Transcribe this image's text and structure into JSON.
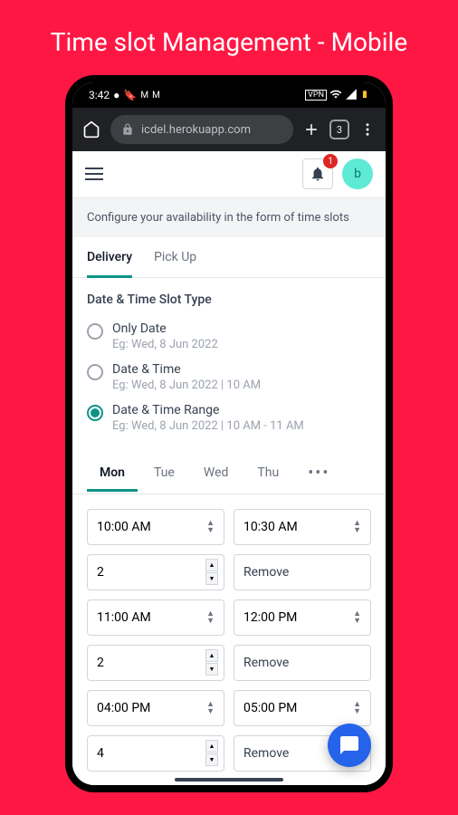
{
  "page": {
    "title": "Time slot Management - Mobile"
  },
  "status": {
    "time": "3:42"
  },
  "browser": {
    "url": "icdel.herokuapp.com",
    "tabs": "3"
  },
  "header": {
    "notification_count": "1",
    "avatar_letter": "b"
  },
  "info": {
    "banner": "Configure your availability in the form of time slots"
  },
  "main_tabs": {
    "delivery": "Delivery",
    "pickup": "Pick Up"
  },
  "slot_type": {
    "title": "Date & Time Slot Type",
    "options": [
      {
        "label": "Only Date",
        "example": "Eg: Wed, 8 Jun 2022",
        "selected": false
      },
      {
        "label": "Date & Time",
        "example": "Eg: Wed, 8 Jun 2022 | 10 AM",
        "selected": false
      },
      {
        "label": "Date & Time Range",
        "example": "Eg: Wed, 8 Jun 2022 | 10 AM - 11 AM",
        "selected": true
      }
    ]
  },
  "days": {
    "mon": "Mon",
    "tue": "Tue",
    "wed": "Wed",
    "thu": "Thu",
    "more": "•••"
  },
  "slots": [
    {
      "start": "10:00 AM",
      "end": "10:30 AM",
      "qty": "2",
      "remove": "Remove"
    },
    {
      "start": "11:00 AM",
      "end": "12:00 PM",
      "qty": "2",
      "remove": "Remove"
    },
    {
      "start": "04:00 PM",
      "end": "05:00 PM",
      "qty": "4",
      "remove": "Remove"
    }
  ]
}
